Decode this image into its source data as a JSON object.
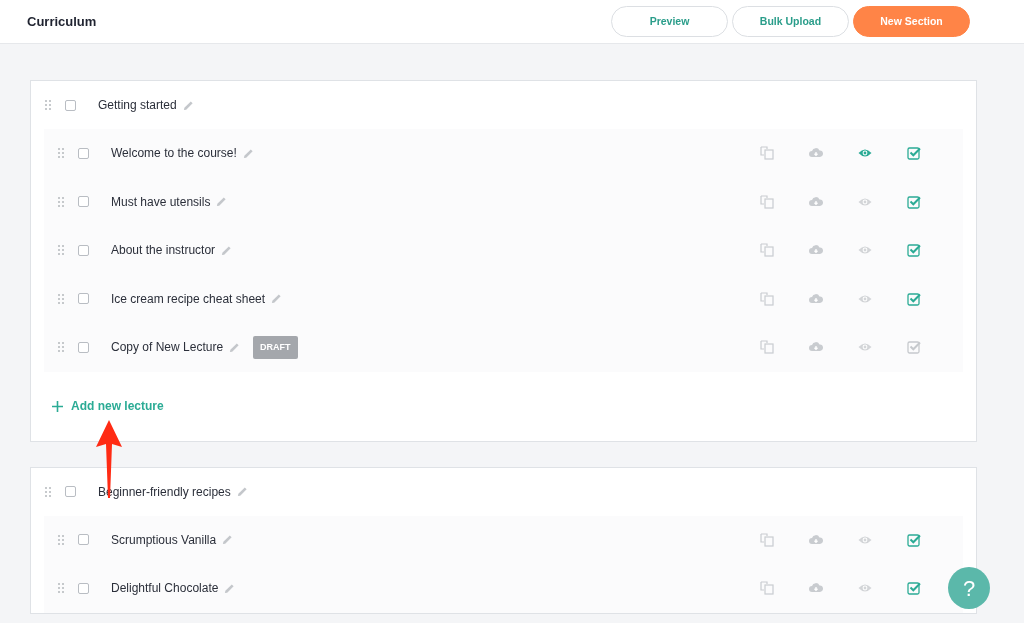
{
  "header": {
    "title": "Curriculum",
    "buttons": [
      {
        "label": "Preview",
        "kind": "outline"
      },
      {
        "label": "Bulk Upload",
        "kind": "outline"
      },
      {
        "label": "New Section",
        "kind": "primary"
      }
    ]
  },
  "sections": [
    {
      "title": "Getting started",
      "checked": false,
      "lectures": [
        {
          "title": "Welcome to the course!",
          "checked": false,
          "preview": true,
          "published": true
        },
        {
          "title": "Must have utensils",
          "checked": false,
          "preview": false,
          "published": true
        },
        {
          "title": "About the instructor",
          "checked": false,
          "preview": false,
          "published": true
        },
        {
          "title": "Ice cream recipe cheat sheet",
          "checked": false,
          "preview": false,
          "published": true
        },
        {
          "title": "Copy of New Lecture",
          "checked": false,
          "preview": false,
          "published": false,
          "badge": "DRAFT"
        }
      ],
      "add_label": "Add new lecture"
    },
    {
      "title": "Beginner-friendly recipes",
      "checked": false,
      "lectures": [
        {
          "title": "Scrumptious Vanilla",
          "checked": false,
          "preview": false,
          "published": true
        },
        {
          "title": "Delightful Chocolate",
          "checked": false,
          "preview": false,
          "published": true
        }
      ]
    }
  ],
  "help_button": "?"
}
